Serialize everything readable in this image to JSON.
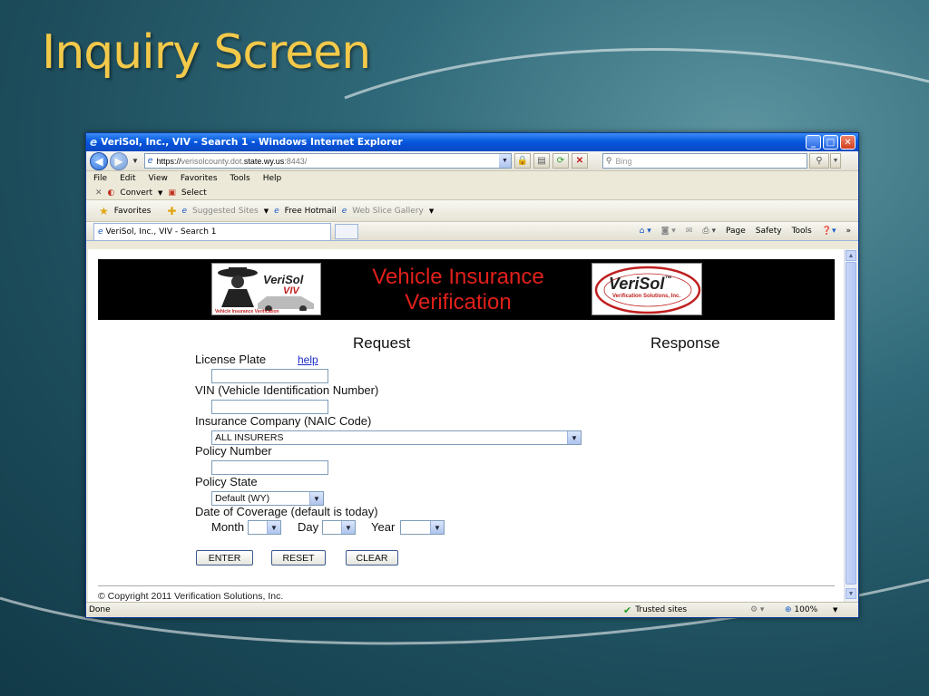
{
  "slide": {
    "title": "Inquiry Screen"
  },
  "window": {
    "title": "VeriSol, Inc., VIV - Search 1 - Windows Internet Explorer",
    "address": {
      "scheme": "https://",
      "pre": "verisolcounty.dot.",
      "host": "state.wy.us",
      "port": ":8443/"
    },
    "search_placeholder": "Bing",
    "menu": [
      "File",
      "Edit",
      "View",
      "Favorites",
      "Tools",
      "Help"
    ],
    "command": {
      "convert": "Convert",
      "select": "Select"
    },
    "favorites": {
      "favorites": "Favorites",
      "suggested": "Suggested Sites",
      "hotmail": "Free Hotmail",
      "webslice": "Web Slice Gallery"
    },
    "tab_label": "VeriSol, Inc., VIV - Search 1",
    "toolbar_right": {
      "page": "Page",
      "safety": "Safety",
      "tools": "Tools"
    },
    "status": {
      "left": "Done",
      "zone": "Trusted sites",
      "zoom": "100%"
    }
  },
  "page": {
    "banner": {
      "line1": "Vehicle Insurance",
      "line2": "Verification",
      "logo_left_brand": "VeriSol",
      "logo_left_sub": "VIV",
      "logo_left_caption": "Vehicle Insurance Verification",
      "logo_right_brand": "VeriSol",
      "logo_right_tm": "™",
      "logo_right_sub": "Verification Solutions, Inc."
    },
    "request_heading": "Request",
    "response_heading": "Response",
    "fields": {
      "license_plate": "License Plate",
      "help": "help",
      "vin": "VIN (Vehicle Identification Number)",
      "insurance_company": "Insurance Company (NAIC Code)",
      "insurance_company_value": "ALL INSURERS",
      "policy_number": "Policy Number",
      "policy_state": "Policy State",
      "policy_state_value": "Default (WY)",
      "date_of_coverage": "Date of Coverage (default is today)",
      "month": "Month",
      "day": "Day",
      "year": "Year"
    },
    "buttons": {
      "enter": "ENTER",
      "reset": "RESET",
      "clear": "CLEAR"
    },
    "footer": "© Copyright 2011 Verification Solutions, Inc."
  }
}
